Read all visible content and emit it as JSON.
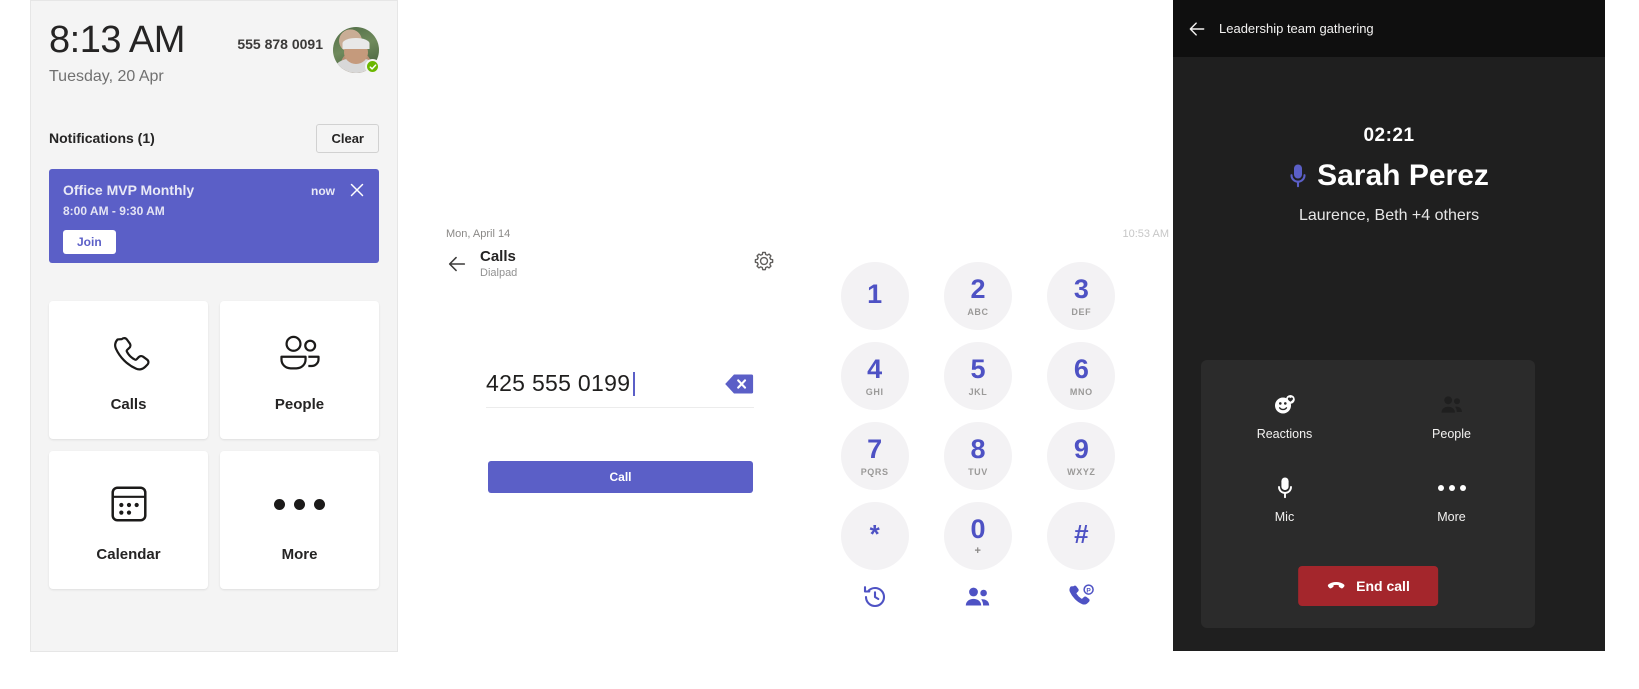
{
  "home": {
    "time": "8:13 AM",
    "date": "Tuesday, 20 Apr",
    "phone_number": "555 878 0091",
    "avatar_name": "avatar",
    "presence": "available",
    "notifications_label": "Notifications (1)",
    "clear_label": "Clear",
    "notification": {
      "title": "Office MVP Monthly",
      "time_range": "8:00 AM - 9:30 AM",
      "when": "now",
      "join_label": "Join",
      "accent": "#5b5fc7"
    },
    "tiles": [
      {
        "label": "Calls",
        "icon": "phone-icon"
      },
      {
        "label": "People",
        "icon": "people-icon"
      },
      {
        "label": "Calendar",
        "icon": "calendar-icon"
      },
      {
        "label": "More",
        "icon": "more-icon"
      }
    ]
  },
  "dialpad": {
    "day_label": "Mon, April 14",
    "title": "Calls",
    "subtitle": "Dialpad",
    "clock": "10:53 AM",
    "number": "425 555 0199",
    "call_label": "Call",
    "accent": "#5b5fc7",
    "keys": [
      {
        "digit": "1",
        "letters": ""
      },
      {
        "digit": "2",
        "letters": "ABC"
      },
      {
        "digit": "3",
        "letters": "DEF"
      },
      {
        "digit": "4",
        "letters": "GHI"
      },
      {
        "digit": "5",
        "letters": "JKL"
      },
      {
        "digit": "6",
        "letters": "MNO"
      },
      {
        "digit": "7",
        "letters": "PQRS"
      },
      {
        "digit": "8",
        "letters": "TUV"
      },
      {
        "digit": "9",
        "letters": "WXYZ"
      },
      {
        "digit": "*",
        "letters": ""
      },
      {
        "digit": "0",
        "letters": "+"
      },
      {
        "digit": "#",
        "letters": ""
      }
    ],
    "actions": [
      {
        "icon": "history-icon"
      },
      {
        "icon": "contacts-icon"
      },
      {
        "icon": "call-park-icon"
      }
    ]
  },
  "meeting": {
    "title": "Leadership team gathering",
    "timer": "02:21",
    "speaker": "Sarah Perez",
    "participants": "Laurence, Beth +4 others",
    "controls": [
      {
        "label": "Reactions",
        "icon": "reactions-icon"
      },
      {
        "label": "People",
        "icon": "people-icon"
      },
      {
        "label": "Mic",
        "icon": "mic-icon"
      },
      {
        "label": "More",
        "icon": "more-icon"
      }
    ],
    "end_call_label": "End call",
    "end_call_color": "#a4262c"
  }
}
